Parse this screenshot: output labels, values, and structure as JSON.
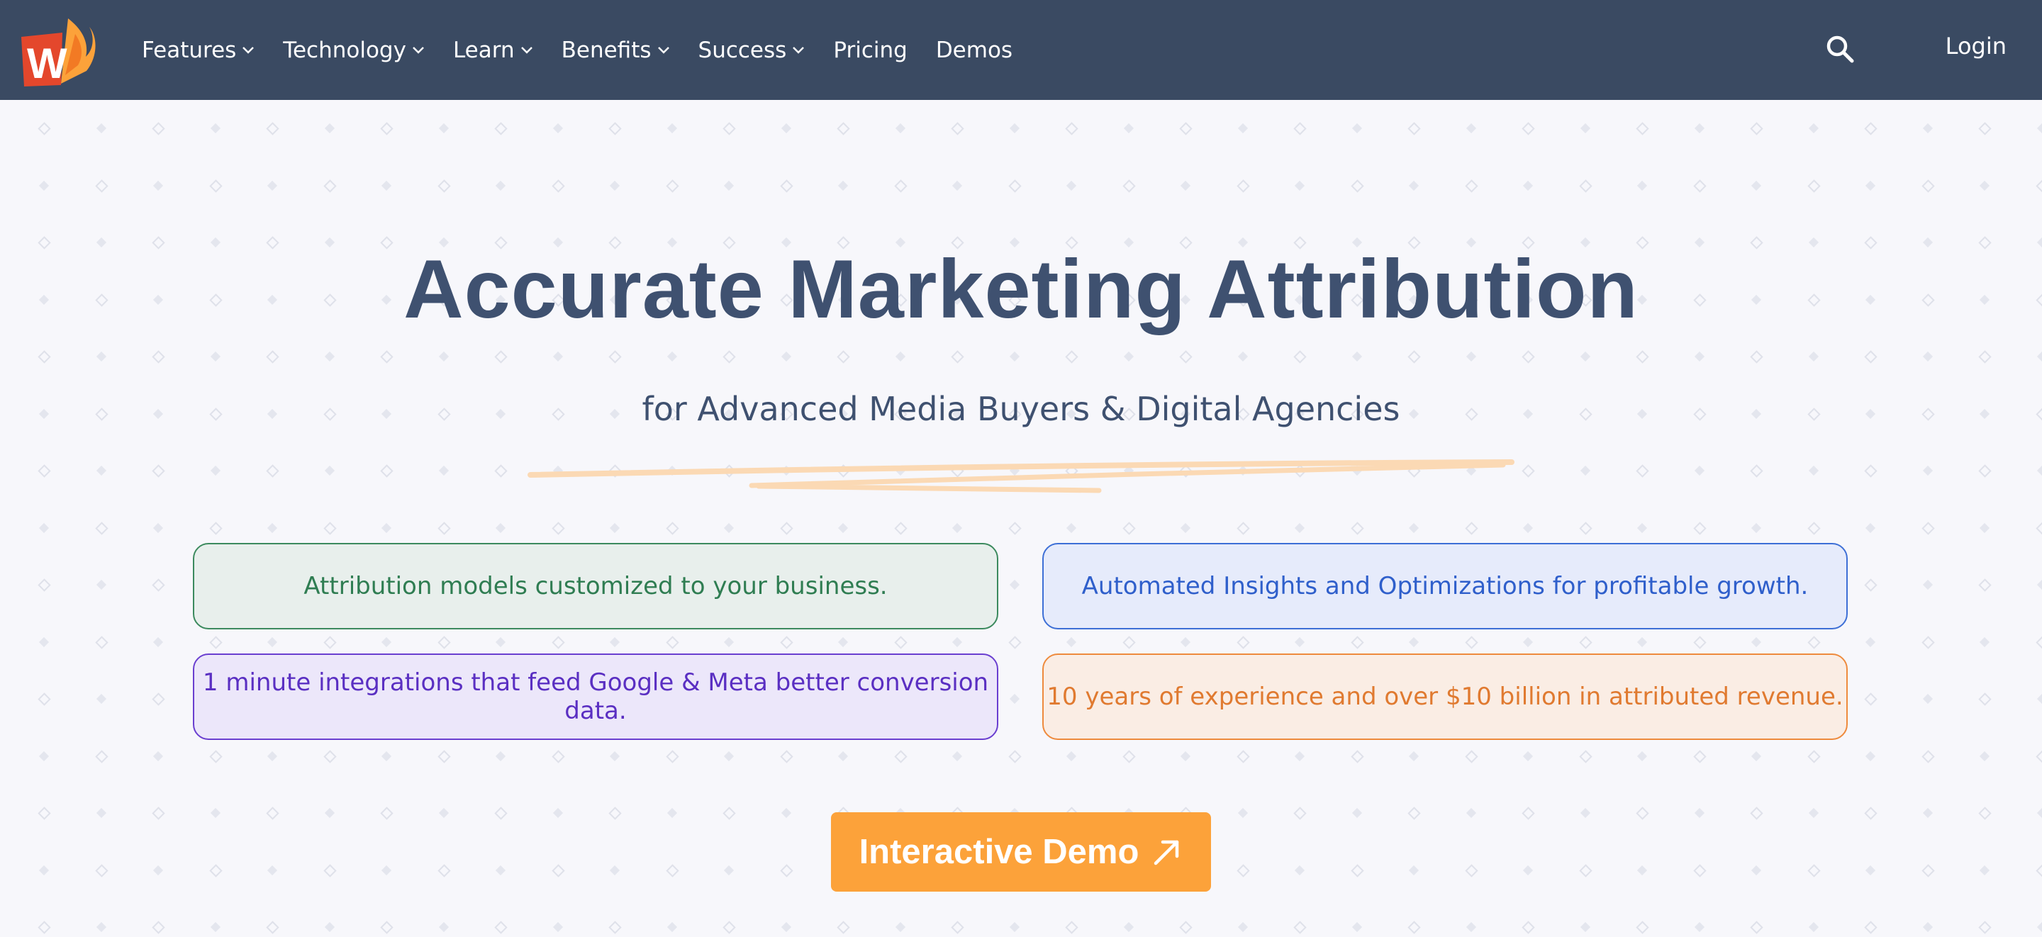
{
  "nav": {
    "logo_letter": "W",
    "items": [
      {
        "label": "Features",
        "has_dropdown": true
      },
      {
        "label": "Technology",
        "has_dropdown": true
      },
      {
        "label": "Learn",
        "has_dropdown": true
      },
      {
        "label": "Benefits",
        "has_dropdown": true
      },
      {
        "label": "Success",
        "has_dropdown": true
      },
      {
        "label": "Pricing",
        "has_dropdown": false
      },
      {
        "label": "Demos",
        "has_dropdown": false
      }
    ],
    "search_icon": "search-icon",
    "login_label": "Login"
  },
  "hero": {
    "title": "Accurate Marketing Attribution",
    "subtitle": "for Advanced Media Buyers & Digital Agencies"
  },
  "features": [
    {
      "text": "Attribution models customized to your business.",
      "color": "#2f7d52"
    },
    {
      "text": "Automated Insights and Optimizations for profitable growth.",
      "color": "#2f5fcb"
    },
    {
      "text": "1 minute integrations that feed Google & Meta better conversion data.",
      "color": "#5a2fc2"
    },
    {
      "text": "10 years of experience and over $10 billion in attributed revenue.",
      "color": "#e07a30"
    }
  ],
  "cta": {
    "label": "Interactive Demo",
    "icon": "arrow-up-right-icon"
  },
  "colors": {
    "nav_bg": "#3a4a62",
    "title": "#3f5170",
    "accent": "#fca23a",
    "page_bg": "#f7f7fb"
  }
}
